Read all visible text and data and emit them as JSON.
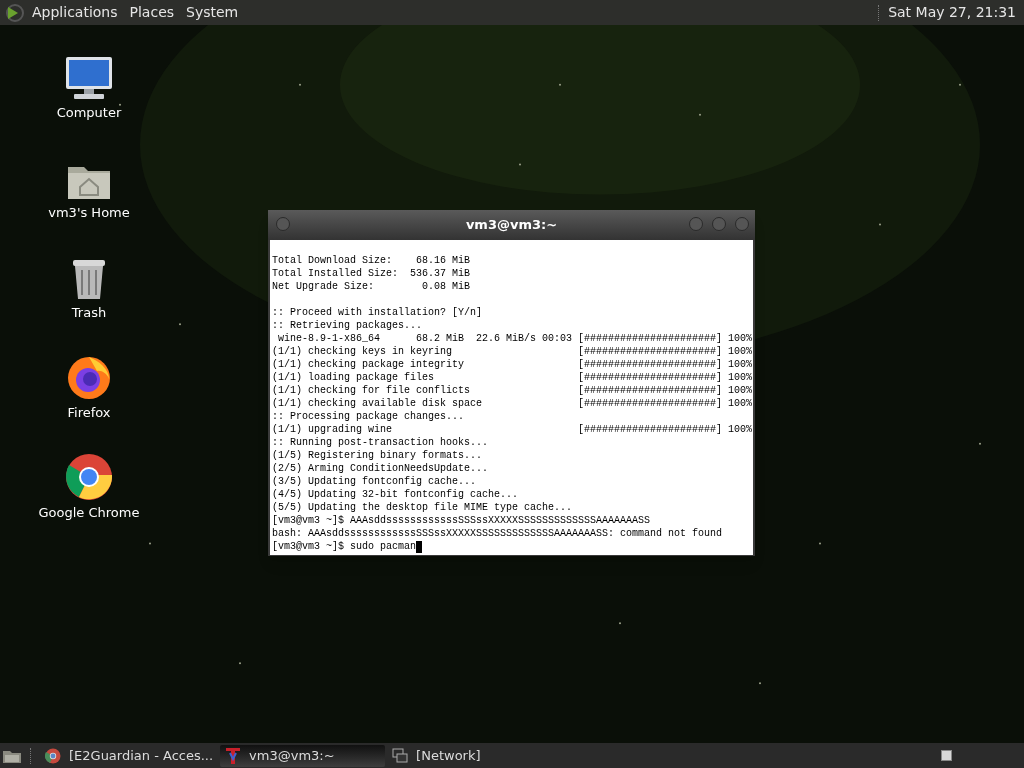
{
  "top_panel": {
    "menus": [
      "Applications",
      "Places",
      "System"
    ],
    "clock": "Sat May 27, 21:31"
  },
  "desktop_icons": [
    {
      "label": "Computer",
      "kind": "computer"
    },
    {
      "label": "vm3's Home",
      "kind": "home"
    },
    {
      "label": "Trash",
      "kind": "trash"
    },
    {
      "label": "Firefox",
      "kind": "firefox"
    },
    {
      "label": "Google Chrome",
      "kind": "chrome"
    }
  ],
  "terminal": {
    "title": "vm3@vm3:~",
    "lines": [
      {
        "kind": "text",
        "text": "Total Download Size:    68.16 MiB"
      },
      {
        "kind": "text",
        "text": "Total Installed Size:  536.37 MiB"
      },
      {
        "kind": "text",
        "text": "Net Upgrade Size:        0.08 MiB"
      },
      {
        "kind": "blank"
      },
      {
        "kind": "text",
        "text": ":: Proceed with installation? [Y/n]"
      },
      {
        "kind": "text",
        "text": ":: Retrieving packages..."
      },
      {
        "kind": "progress",
        "text": " wine-8.9-1-x86_64      68.2 MiB  22.6 MiB/s 00:03",
        "bar": "[######################] 100%"
      },
      {
        "kind": "progress",
        "text": "(1/1) checking keys in keyring",
        "bar": "[######################] 100%"
      },
      {
        "kind": "progress",
        "text": "(1/1) checking package integrity",
        "bar": "[######################] 100%"
      },
      {
        "kind": "progress",
        "text": "(1/1) loading package files",
        "bar": "[######################] 100%"
      },
      {
        "kind": "progress",
        "text": "(1/1) checking for file conflicts",
        "bar": "[######################] 100%"
      },
      {
        "kind": "progress",
        "text": "(1/1) checking available disk space",
        "bar": "[######################] 100%"
      },
      {
        "kind": "text",
        "text": ":: Processing package changes..."
      },
      {
        "kind": "progress",
        "text": "(1/1) upgrading wine",
        "bar": "[######################] 100%"
      },
      {
        "kind": "text",
        "text": ":: Running post-transaction hooks..."
      },
      {
        "kind": "text",
        "text": "(1/5) Registering binary formats..."
      },
      {
        "kind": "text",
        "text": "(2/5) Arming ConditionNeedsUpdate..."
      },
      {
        "kind": "text",
        "text": "(3/5) Updating fontconfig cache..."
      },
      {
        "kind": "text",
        "text": "(4/5) Updating 32-bit fontconfig cache..."
      },
      {
        "kind": "text",
        "text": "(5/5) Updating the desktop file MIME type cache..."
      },
      {
        "kind": "text",
        "text": "[vm3@vm3 ~]$ AAAsddssssssssssssSSSssXXXXXSSSSSSSSSSSSSAAAAAAASS"
      },
      {
        "kind": "text",
        "text": "bash: AAAsddssssssssssssSSSssXXXXXSSSSSSSSSSSSSAAAAAAASS: command not found"
      },
      {
        "kind": "prompt",
        "text": "[vm3@vm3 ~]$ sudo pacman"
      }
    ]
  },
  "taskbar": {
    "tasks": [
      {
        "label": "[E2Guardian - Acces...",
        "kind": "chrome",
        "selected": false
      },
      {
        "label": "vm3@vm3:~",
        "kind": "terminal",
        "selected": true
      },
      {
        "label": "[Network]",
        "kind": "window",
        "selected": false
      }
    ]
  }
}
